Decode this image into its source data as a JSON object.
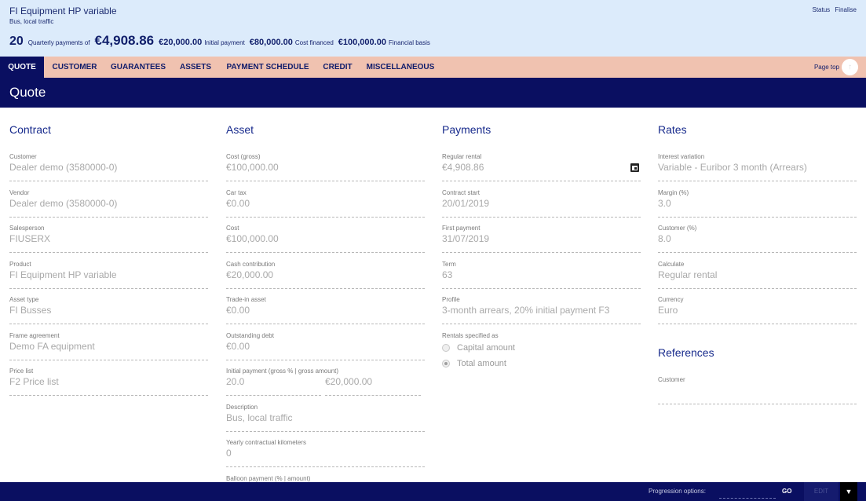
{
  "header": {
    "title": "FI Equipment HP variable",
    "subtitle": "Bus, local traffic",
    "summary": {
      "payments_count": "20",
      "payments_text": "Quarterly payments of",
      "payment_amount": "€4,908.86",
      "initial_payment_value": "€20,000.00",
      "initial_payment_label": "Initial payment",
      "cost_financed_value": "€80,000.00",
      "cost_financed_label": "Cost financed",
      "financial_basis_value": "€100,000.00",
      "financial_basis_label": "Financial basis"
    },
    "links": {
      "status": "Status",
      "finalise": "Finalise"
    }
  },
  "tabs": [
    {
      "label": "QUOTE",
      "active": true
    },
    {
      "label": "CUSTOMER"
    },
    {
      "label": "GUARANTEES"
    },
    {
      "label": "ASSETS"
    },
    {
      "label": "PAYMENT SCHEDULE"
    },
    {
      "label": "CREDIT"
    },
    {
      "label": "MISCELLANEOUS"
    }
  ],
  "page_top": {
    "label": "Page top",
    "icon": "arrow-up-icon"
  },
  "section_title": "Quote",
  "contract": {
    "heading": "Contract",
    "fields": [
      {
        "label": "Customer",
        "value": "Dealer demo (3580000-0)"
      },
      {
        "label": "Vendor",
        "value": "Dealer demo (3580000-0)"
      },
      {
        "label": "Salesperson",
        "value": "FIUSERX"
      },
      {
        "label": "Product",
        "value": "FI Equipment HP variable"
      },
      {
        "label": "Asset type",
        "value": "FI Busses"
      },
      {
        "label": "Frame agreement",
        "value": "Demo FA equipment"
      },
      {
        "label": "Price list",
        "value": "F2 Price list"
      }
    ]
  },
  "asset": {
    "heading": "Asset",
    "fields": [
      {
        "label": "Cost (gross)",
        "value": "€100,000.00"
      },
      {
        "label": "Car tax",
        "value": "€0.00"
      },
      {
        "label": "Cost",
        "value": "€100,000.00"
      },
      {
        "label": "Cash contribution",
        "value": "€20,000.00"
      },
      {
        "label": "Trade-in asset",
        "value": "€0.00"
      },
      {
        "label": "Outstanding debt",
        "value": "€0.00"
      }
    ],
    "initial_payment": {
      "label": "Initial payment (gross % | gross amount)",
      "percent": "20.0",
      "amount": "€20,000.00"
    },
    "description": {
      "label": "Description",
      "value": "Bus, local traffic"
    },
    "yearly_km": {
      "label": "Yearly contractual kilometers",
      "value": "0"
    },
    "balloon": {
      "label": "Balloon payment (% | amount)"
    }
  },
  "payments": {
    "heading": "Payments",
    "fields": [
      {
        "label": "Regular rental",
        "value": "€4,908.86"
      },
      {
        "label": "Contract start",
        "value": "20/01/2019"
      },
      {
        "label": "First payment",
        "value": "31/07/2019"
      },
      {
        "label": "Term",
        "value": "63"
      },
      {
        "label": "Profile",
        "value": "3-month arrears, 20% initial payment F3"
      }
    ],
    "calendar_icon": "calendar-icon",
    "rentals": {
      "label": "Rentals specified as",
      "options": [
        {
          "label": "Capital amount",
          "checked": false
        },
        {
          "label": "Total amount",
          "checked": true
        }
      ]
    }
  },
  "rates": {
    "heading": "Rates",
    "fields": [
      {
        "label": "Interest variation",
        "value": "Variable - Euribor 3 month (Arrears)"
      },
      {
        "label": "Margin (%)",
        "value": "3.0"
      },
      {
        "label": "Customer (%)",
        "value": "8.0"
      },
      {
        "label": "Calculate",
        "value": "Regular rental"
      },
      {
        "label": "Currency",
        "value": "Euro"
      }
    ]
  },
  "references": {
    "heading": "References",
    "fields": [
      {
        "label": "Customer",
        "value": ""
      }
    ]
  },
  "footer": {
    "progression_label": "Progression options:",
    "go_label": "GO",
    "edit_label": "EDIT",
    "dropdown_icon": "caret-down-icon"
  }
}
